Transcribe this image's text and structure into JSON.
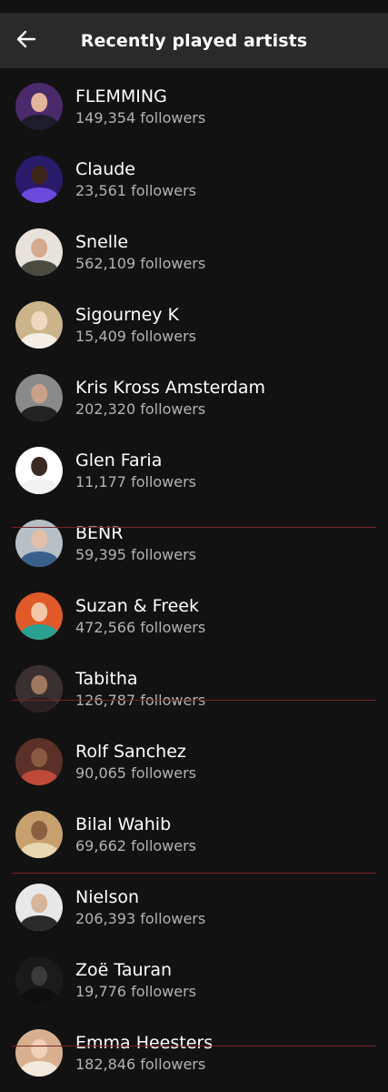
{
  "header": {
    "title": "Recently played artists",
    "back_icon": "arrow-left-icon"
  },
  "colors": {
    "background": "#121212",
    "header": "#2a2a2a",
    "text_primary": "#ffffff",
    "text_secondary": "#b3b3b3",
    "separator_red": "#7a2222"
  },
  "artists": [
    {
      "name": "FLEMMING",
      "followers": "149,354 followers",
      "avatar_bg": "#4a2a6a",
      "skin": "#e2b49a",
      "shirt": "#1c1c2a"
    },
    {
      "name": "Claude",
      "followers": "23,561 followers",
      "avatar_bg": "#2a1a6a",
      "skin": "#3b2418",
      "shirt": "#6a4adc"
    },
    {
      "name": "Snelle",
      "followers": "562,109 followers",
      "avatar_bg": "#e8e2dc",
      "skin": "#d7a890",
      "shirt": "#4a4a40"
    },
    {
      "name": "Sigourney K",
      "followers": "15,409 followers",
      "avatar_bg": "#cbb48a",
      "skin": "#f0d8c0",
      "shirt": "#f4efe6"
    },
    {
      "name": "Kris Kross Amsterdam",
      "followers": "202,320 followers",
      "avatar_bg": "#8a8a8a",
      "skin": "#c9a08a",
      "shirt": "#222222"
    },
    {
      "name": "Glen Faria",
      "followers": "11,177 followers",
      "avatar_bg": "#ffffff",
      "skin": "#3a2a22",
      "shirt": "#f2f2f2"
    },
    {
      "name": "BENR",
      "followers": "59,395 followers",
      "avatar_bg": "#b7bfc7",
      "skin": "#e0c0a8",
      "shirt": "#3a5f8a"
    },
    {
      "name": "Suzan & Freek",
      "followers": "472,566 followers",
      "avatar_bg": "#e05a2a",
      "skin": "#f0c8a8",
      "shirt": "#2aa090"
    },
    {
      "name": "Tabitha",
      "followers": "126,787 followers",
      "avatar_bg": "#3a3030",
      "skin": "#a07860",
      "shirt": "#2a2222"
    },
    {
      "name": "Rolf Sanchez",
      "followers": "90,065 followers",
      "avatar_bg": "#5a3028",
      "skin": "#8a5a40",
      "shirt": "#c04a3a"
    },
    {
      "name": "Bilal Wahib",
      "followers": "69,662 followers",
      "avatar_bg": "#c8a070",
      "skin": "#8a6040",
      "shirt": "#e8d8b0"
    },
    {
      "name": "Nielson",
      "followers": "206,393 followers",
      "avatar_bg": "#e8e8e8",
      "skin": "#d8b49a",
      "shirt": "#2a2a2a"
    },
    {
      "name": "Zoë Tauran",
      "followers": "19,776 followers",
      "avatar_bg": "#1a1a1a",
      "skin": "#3a3a3a",
      "shirt": "#0e0e0e"
    },
    {
      "name": "Emma Heesters",
      "followers": "182,846 followers",
      "avatar_bg": "#d8b090",
      "skin": "#f0d0b8",
      "shirt": "#f2e8dc"
    }
  ]
}
